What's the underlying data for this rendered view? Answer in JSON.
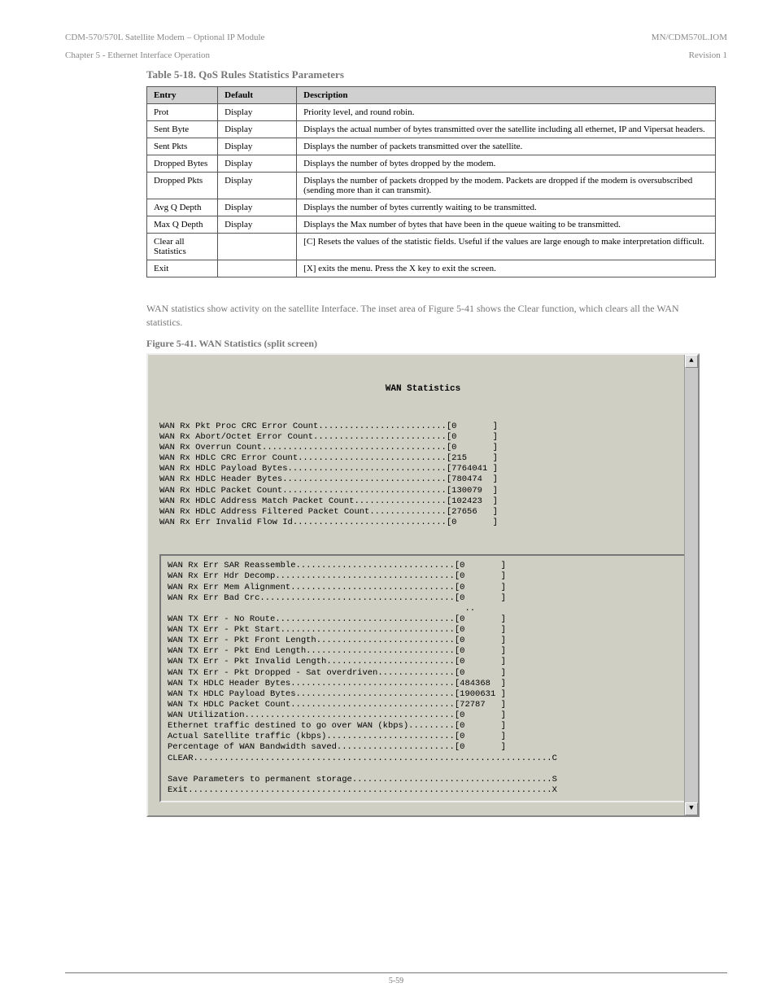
{
  "header": {
    "left": "Chapter 5 - Ethernet Interface Operation",
    "right": "Revision 1",
    "doc_left": "CDM-570/570L Satellite Modem – Optional IP Module",
    "doc_right": "MN/CDM570L.IOM"
  },
  "params_title": "Table 5-18. QoS Rules Statistics Parameters",
  "params_table": {
    "columns": [
      "Entry",
      "Default",
      "Description"
    ],
    "rows": [
      {
        "entry": "Prot",
        "default": "Display",
        "desc": "Priority level, and round robin."
      },
      {
        "entry": "Sent Byte",
        "default": "Display",
        "desc": "Displays the actual number of bytes transmitted over the satellite including all ethernet, IP and Vipersat headers."
      },
      {
        "entry": "Sent Pkts",
        "default": "Display",
        "desc": "Displays the number of packets transmitted over the satellite."
      },
      {
        "entry": "Dropped Bytes",
        "default": "Display",
        "desc": "Displays the number of bytes dropped by the modem."
      },
      {
        "entry": "Dropped Pkts",
        "default": "Display",
        "desc": "Displays the number of packets dropped by the modem. Packets are dropped if the modem is oversubscribed (sending more than it can transmit)."
      },
      {
        "entry": "Avg Q Depth",
        "default": "Display",
        "desc": "Displays the number of bytes currently waiting to be transmitted."
      },
      {
        "entry": "Max Q Depth",
        "default": "Display",
        "desc": "Displays the Max number of bytes that have been in the queue waiting to be transmitted."
      },
      {
        "entry": "Clear all Statistics",
        "default": "",
        "desc": "[C] Resets the values of the statistic fields. Useful if the values are large enough to make interpretation difficult."
      },
      {
        "entry": "Exit",
        "default": "",
        "desc": "[X] exits the menu. Press the X key to exit the screen."
      }
    ]
  },
  "narrative": "WAN statistics show activity on the satellite Interface. The inset area of Figure 5-41 shows the Clear function, which clears all the WAN statistics.",
  "figure_caption": "Figure 5-41. WAN Statistics (split screen)",
  "terminal": {
    "title": "WAN Statistics",
    "upper": [
      {
        "label": "WAN Rx Pkt Proc CRC Error Count",
        "value": "0"
      },
      {
        "label": "WAN Rx Abort/Octet Error Count",
        "value": "0"
      },
      {
        "label": "WAN Rx Overrun Count",
        "value": "0"
      },
      {
        "label": "WAN Rx HDLC CRC Error Count",
        "value": "215"
      },
      {
        "label": "WAN Rx HDLC Payload Bytes",
        "value": "7764041"
      },
      {
        "label": "WAN Rx HDLC Header Bytes",
        "value": "780474"
      },
      {
        "label": "WAN Rx HDLC Packet Count",
        "value": "130079"
      },
      {
        "label": "WAN Rx HDLC Address Match Packet Count",
        "value": "102423"
      },
      {
        "label": "WAN Rx HDLC Address Filtered Packet Count",
        "value": "27656"
      },
      {
        "label": "WAN Rx Err Invalid Flow Id",
        "value": "0"
      }
    ],
    "inner": [
      {
        "label": "WAN Rx Err SAR Reassemble",
        "value": "0"
      },
      {
        "label": "WAN Rx Err Hdr Decomp",
        "value": "0"
      },
      {
        "label": "WAN Rx Err Mem Alignment",
        "value": "0"
      },
      {
        "label": "WAN Rx Err Bad Crc",
        "value": "0"
      },
      {
        "sep": ".."
      },
      {
        "label": "WAN TX Err - No Route",
        "value": "0"
      },
      {
        "label": "WAN TX Err - Pkt Start",
        "value": "0"
      },
      {
        "label": "WAN TX Err - Pkt Front Length",
        "value": "0"
      },
      {
        "label": "WAN TX Err - Pkt End Length",
        "value": "0"
      },
      {
        "label": "WAN TX Err - Pkt Invalid Length",
        "value": "0"
      },
      {
        "label": "WAN TX Err - Pkt Dropped - Sat overdriven",
        "value": "0"
      },
      {
        "label": "WAN Tx HDLC Header Bytes",
        "value": "484368"
      },
      {
        "label": "WAN Tx HDLC Payload Bytes",
        "value": "1900631"
      },
      {
        "label": "WAN Tx HDLC Packet Count",
        "value": "72787"
      },
      {
        "label": "WAN Utilization",
        "value": "0"
      },
      {
        "label": "Ethernet traffic destined to go over WAN (kbps)",
        "value": "0"
      },
      {
        "label": "Actual Satellite traffic (kbps)",
        "value": "0"
      },
      {
        "label": "Percentage of WAN Bandwidth saved",
        "value": "0"
      },
      {
        "label": "CLEAR",
        "cmd": "C"
      },
      {
        "blank": true
      },
      {
        "label": "Save Parameters to permanent storage",
        "cmd": "S"
      },
      {
        "label": "Exit",
        "cmd": "X"
      }
    ]
  },
  "footer": {
    "left": "",
    "center": "5-59",
    "right": ""
  }
}
